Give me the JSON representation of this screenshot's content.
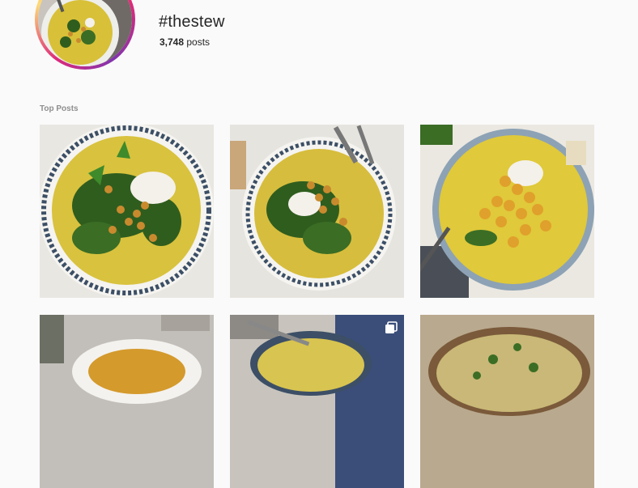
{
  "header": {
    "hashtag": "#thestew",
    "post_count": "3,748",
    "post_label": "posts"
  },
  "sections": {
    "top_posts_title": "Top Posts"
  },
  "posts": [
    {
      "id": "post-1",
      "icon": "none"
    },
    {
      "id": "post-2",
      "icon": "none"
    },
    {
      "id": "post-3",
      "icon": "none"
    },
    {
      "id": "post-4",
      "icon": "none"
    },
    {
      "id": "post-5",
      "icon": "multiple-photos-icon"
    },
    {
      "id": "post-6",
      "icon": "none"
    }
  ],
  "colors": {
    "stew_yellow": "#d9c23e",
    "greens": "#2f5d1e",
    "chickpea": "#c98a2e",
    "yogurt": "#f4f1ea",
    "label_grey": "#8e8e8e"
  }
}
